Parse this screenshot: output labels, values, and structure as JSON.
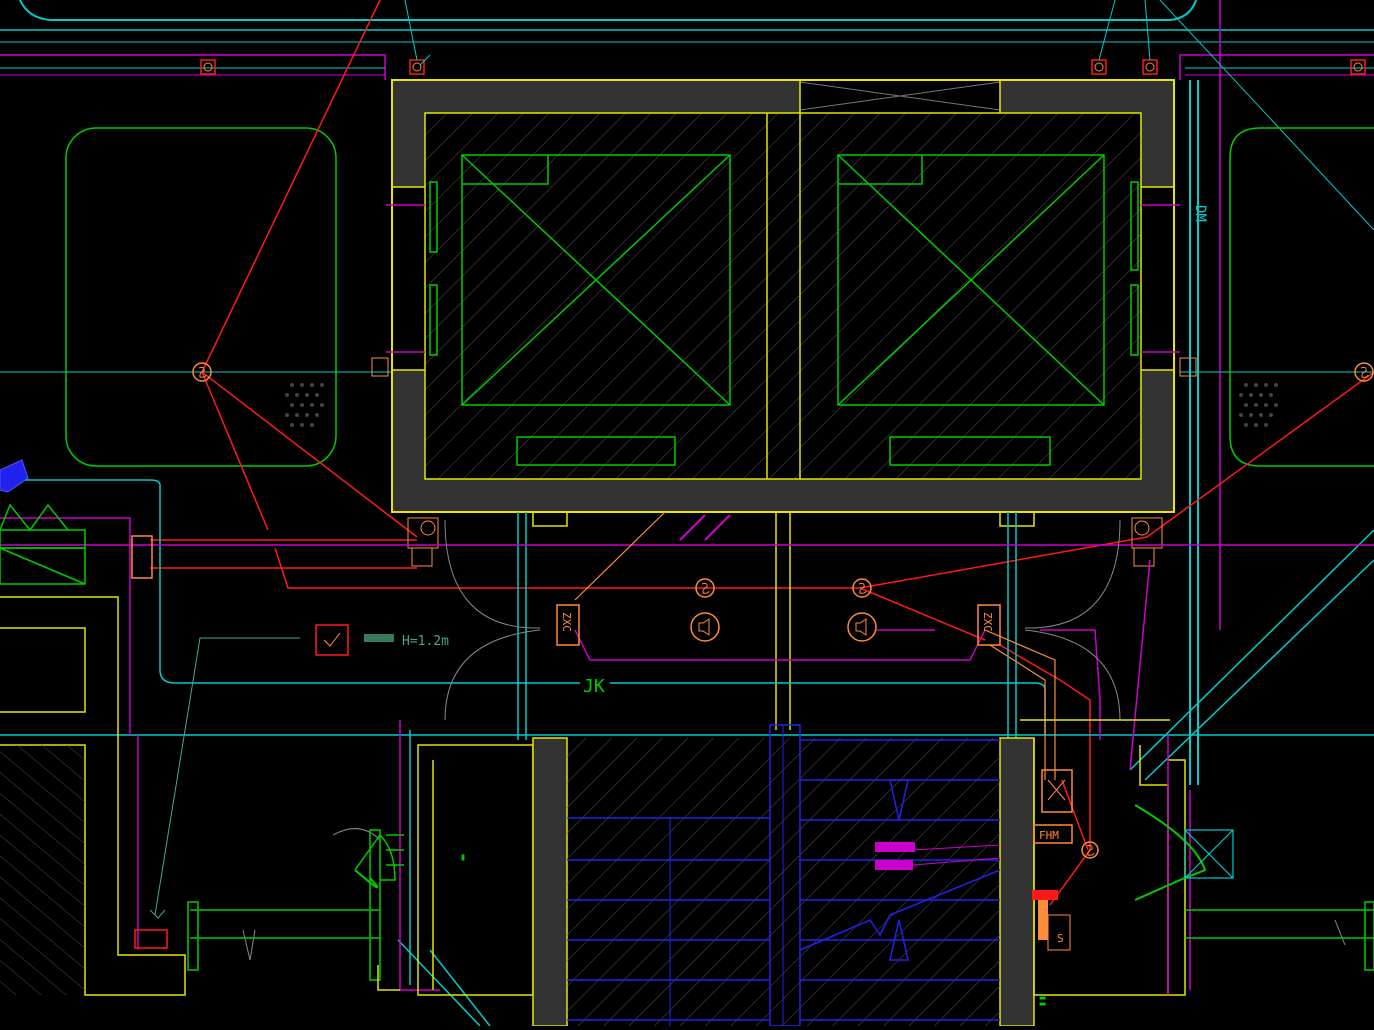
{
  "labels": {
    "jk": "JK",
    "zxc_left": "ZXC",
    "zxc_right": "ZXC",
    "fhm": "FHM",
    "dm": "DM",
    "height_note": "H=1.2m",
    "switch_s": "S"
  },
  "colors": {
    "background": "#000000",
    "wall_fill": "#333333",
    "yellow": "#e6e600",
    "green": "#00cc00",
    "cyan": "#00cccc",
    "magenta": "#cc00cc",
    "red": "#ff1a1a",
    "orange": "#ff8c3a",
    "blue": "#2222ee"
  }
}
